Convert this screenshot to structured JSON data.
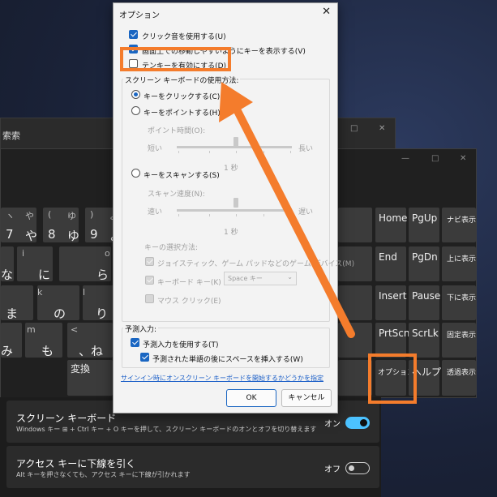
{
  "search_window": {
    "title": "索索",
    "controls": [
      "□",
      "✕"
    ]
  },
  "osk": {
    "controls": [
      "—",
      "□",
      "✕"
    ],
    "keys_row1": [
      {
        "top": "ヽ",
        "right": "や",
        "main": "7",
        "main_r": "や"
      },
      {
        "top": "(",
        "right": "ゆ",
        "main": "8",
        "main_r": "ゆ"
      },
      {
        "top": ")",
        "right": "よ",
        "main": "9",
        "main_r": "よ"
      }
    ],
    "left_keys": {
      "r2": [
        {
          "top": "i",
          "main": "な"
        },
        {
          "top": "i",
          "main": "に"
        },
        {
          "top": "o",
          "main": "ら"
        }
      ],
      "r3": [
        {
          "top": "",
          "main": "ま"
        },
        {
          "top": "k",
          "main": "の"
        },
        {
          "top": "l",
          "main": "り"
        }
      ],
      "r4": [
        {
          "top": "",
          "main": "み"
        },
        {
          "top": "m",
          "main": "も"
        },
        {
          "top": "<",
          "main": "、ね"
        }
      ],
      "r5": {
        "label": "変換"
      }
    },
    "nav_keys": [
      [
        "Home",
        "PgUp",
        "ナビ表示"
      ],
      [
        "End",
        "PgDn",
        "上に表示"
      ],
      [
        "Insert",
        "Pause",
        "下に表示"
      ],
      [
        "PrtScn",
        "ScrLk",
        "固定表示"
      ],
      [
        "オプション",
        "ヘルプ",
        "透過表示"
      ]
    ]
  },
  "settings": {
    "rows": [
      {
        "title": "スクリーン キーボード",
        "desc": "Windows キー ⊞ + Ctrl キー + O キーを押して、スクリーン キーボードのオンとオフを切り替えます",
        "state": "オン"
      },
      {
        "title": "アクセス キーに下線を引く",
        "desc": "Alt キーを押さなくても、アクセス キーに下線が引かれます",
        "state": "オフ"
      }
    ]
  },
  "dialog": {
    "title": "オプション",
    "close": "✕",
    "click_sound": "クリック音を使用する(U)",
    "move_keys": "画面上での移動しやすいようにキーを表示する(V)",
    "numpad": "テンキーを有効にする(D)",
    "usage_group": "スクリーン キーボードの使用方法:",
    "click_keys": "キーをクリックする(C)",
    "hover_keys": "キーをポイントする(H)",
    "hover_time": "ポイント時間(O):",
    "short": "短い",
    "long": "長い",
    "seconds_1": "1 秒",
    "scan_keys": "キーをスキャンする(S)",
    "scan_speed": "スキャン速度(N):",
    "fast": "速い",
    "slow": "遅い",
    "seconds_2": "1 秒",
    "select_method": "キーの選択方法:",
    "joystick": "ジョイスティック、ゲーム パッドなどのゲーム デバイス(M)",
    "keyboard_key": "キーボード キー(K)",
    "space_key": "Space キー",
    "mouse_click": "マウス クリック(E)",
    "prediction_group": "予測入力:",
    "use_prediction": "予測入力を使用する(T)",
    "insert_space": "予測された単語の後にスペースを挿入する(W)",
    "signin_link": "サインイン時にオンスクリーン キーボードを開始するかどうかを指定",
    "ok": "OK",
    "cancel": "キャンセル"
  },
  "colors": {
    "annotation": "#f47c2c",
    "accent": "#1a66c2",
    "toggle_on": "#4cc2ff"
  }
}
